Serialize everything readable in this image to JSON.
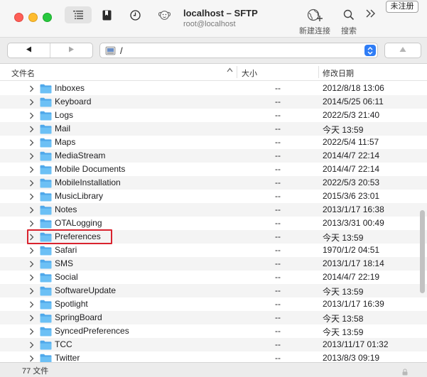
{
  "titlebar": {
    "title": "localhost – SFTP",
    "subtitle": "root@localhost",
    "new_connection_label": "新建连接",
    "search_label": "搜索",
    "unregistered_label": "未注册"
  },
  "pathbar": {
    "path": "/"
  },
  "columns": {
    "name": "文件名",
    "size": "大小",
    "modified": "修改日期"
  },
  "rows": [
    {
      "name": "Inboxes",
      "size": "--",
      "date": "2012/8/18 13:06"
    },
    {
      "name": "Keyboard",
      "size": "--",
      "date": "2014/5/25 06:11"
    },
    {
      "name": "Logs",
      "size": "--",
      "date": "2022/5/3 21:40"
    },
    {
      "name": "Mail",
      "size": "--",
      "date": "今天 13:59"
    },
    {
      "name": "Maps",
      "size": "--",
      "date": "2022/5/4 11:57"
    },
    {
      "name": "MediaStream",
      "size": "--",
      "date": "2014/4/7 22:14"
    },
    {
      "name": "Mobile Documents",
      "size": "--",
      "date": "2014/4/7 22:14"
    },
    {
      "name": "MobileInstallation",
      "size": "--",
      "date": "2022/5/3 20:53"
    },
    {
      "name": "MusicLibrary",
      "size": "--",
      "date": "2015/3/6 23:01"
    },
    {
      "name": "Notes",
      "size": "--",
      "date": "2013/1/17 16:38"
    },
    {
      "name": "OTALogging",
      "size": "--",
      "date": "2013/3/31 00:49"
    },
    {
      "name": "Preferences",
      "size": "--",
      "date": "今天 13:59"
    },
    {
      "name": "Safari",
      "size": "--",
      "date": "1970/1/2 04:51"
    },
    {
      "name": "SMS",
      "size": "--",
      "date": "2013/1/17 18:14"
    },
    {
      "name": "Social",
      "size": "--",
      "date": "2014/4/7 22:19"
    },
    {
      "name": "SoftwareUpdate",
      "size": "--",
      "date": "今天 13:59"
    },
    {
      "name": "Spotlight",
      "size": "--",
      "date": "2013/1/17 16:39"
    },
    {
      "name": "SpringBoard",
      "size": "--",
      "date": "今天 13:58"
    },
    {
      "name": "SyncedPreferences",
      "size": "--",
      "date": "今天 13:59"
    },
    {
      "name": "TCC",
      "size": "--",
      "date": "2013/11/17 01:32"
    },
    {
      "name": "Twitter",
      "size": "--",
      "date": "2013/8/3 09:19"
    }
  ],
  "highlighted_row": "Preferences",
  "status": {
    "count": "77 文件"
  },
  "colors": {
    "folder": "#59b4f0",
    "highlight_border": "#d9232e",
    "stepper": "#2f7df6"
  },
  "icons": {
    "outline": "outline-view-icon",
    "bookmark": "bookmark-icon",
    "history": "history-clock-icon",
    "app": "monkey-icon",
    "new_connection": "globe-plus-icon",
    "search": "search-icon",
    "more": "chevron-double-right-icon",
    "folder": "folder-icon",
    "lock": "lock-icon"
  }
}
